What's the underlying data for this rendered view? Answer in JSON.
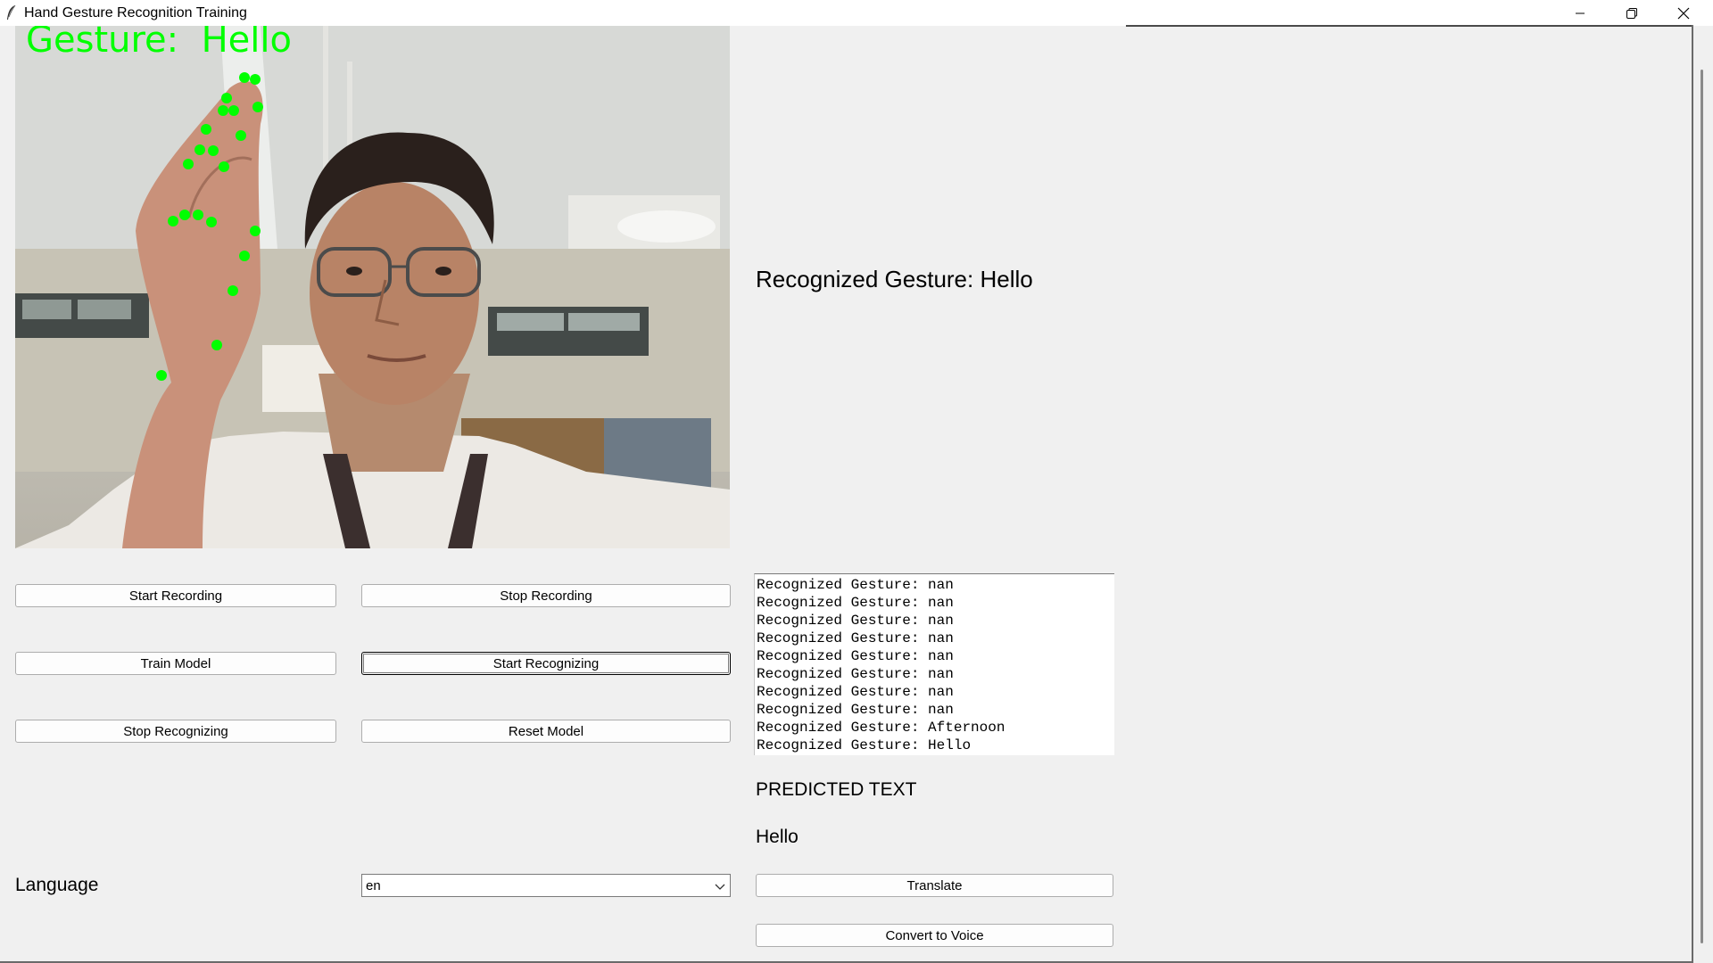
{
  "window": {
    "title": "Hand Gesture Recognition Training",
    "controls": [
      "minimize",
      "restore",
      "close"
    ]
  },
  "camera": {
    "overlay_text": "Gesture:  Hello",
    "overlay_color": "#00ff00",
    "landmark_color": "#00ff00"
  },
  "recognized": {
    "label": "Recognized Gesture: Hello"
  },
  "buttons": {
    "start_recording": "Start Recording",
    "stop_recording": "Stop Recording",
    "train_model": "Train Model",
    "start_recognizing": "Start Recognizing",
    "stop_recognizing": "Stop Recognizing",
    "reset_model": "Reset Model",
    "translate": "Translate",
    "convert_to_voice": "Convert to Voice"
  },
  "log": {
    "lines": [
      "Recognized Gesture: nan",
      "Recognized Gesture: nan",
      "Recognized Gesture: nan",
      "Recognized Gesture: nan",
      "Recognized Gesture: nan",
      "Recognized Gesture: nan",
      "Recognized Gesture: nan",
      "Recognized Gesture: nan",
      "Recognized Gesture: Afternoon",
      "Recognized Gesture: Hello"
    ]
  },
  "prediction": {
    "heading": "PREDICTED TEXT",
    "value": "Hello"
  },
  "language": {
    "label": "Language",
    "selected": "en"
  }
}
